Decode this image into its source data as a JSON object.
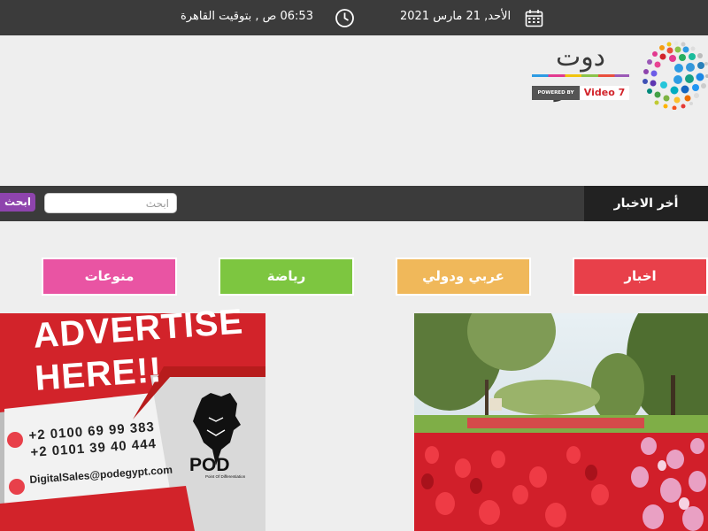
{
  "topbar": {
    "date": "الأحد, 21 مارس 2021",
    "time": "06:53 ص , بتوقيت القاهرة",
    "calendar_icon": "calendar-icon",
    "clock_icon": "clock-icon"
  },
  "header": {
    "logo_text": "دوت مصر",
    "powered_by": "POWERED BY",
    "video7": "Video 7"
  },
  "newsbar": {
    "latest_label": "أخر الاخبار",
    "search_placeholder": "ابحث",
    "search_button": "ابحث"
  },
  "categories": [
    {
      "label": "اخبار",
      "color": "#e8404a"
    },
    {
      "label": "عربي ودولي",
      "color": "#f0b85a"
    },
    {
      "label": "رياضة",
      "color": "#7dc640"
    },
    {
      "label": "منوعات",
      "color": "#e954a3"
    }
  ],
  "ad": {
    "title_line1": "ADVERTISE",
    "title_line2": "HERE!!",
    "phone1": "+2 0100 69 99 383",
    "phone2": "+2 0101 39 40 444",
    "email": "DigitalSales@podegypt.com",
    "brand": "POD",
    "brand_tagline": "Point Of Differentiation"
  },
  "colors": {
    "topbar_bg": "#3b3b3b",
    "newsbar_bg": "#3b3b3b",
    "latest_bg": "#222222",
    "search_button_bg": "#8e44ad",
    "page_bg": "#eeeeee",
    "ad_red": "#d2232a"
  }
}
